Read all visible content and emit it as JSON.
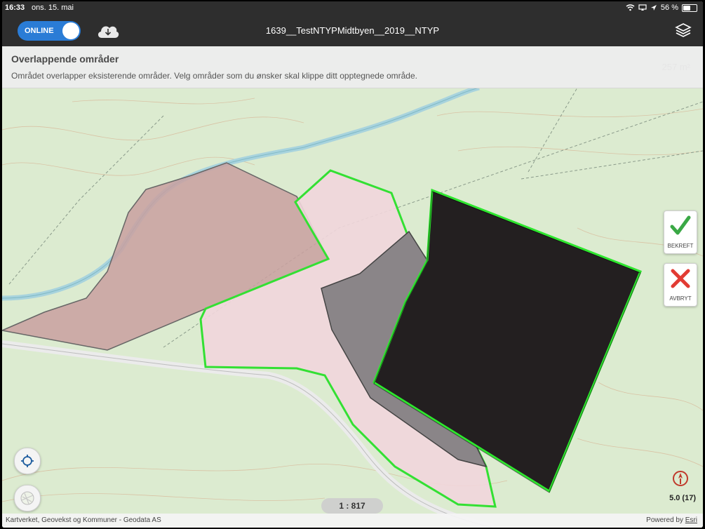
{
  "status_bar": {
    "time": "16:33",
    "date": "ons. 15. mai",
    "battery": "56 %",
    "battery_level": 0.56
  },
  "toolbar": {
    "online_label": "ONLINE",
    "title": "1639__TestNTYPMidtbyen__2019__NTYP"
  },
  "banner": {
    "title": "Overlappende områder",
    "message": "Området overlapper eksisterende områder. Velg områder som du ønsker skal klippe ditt opptegnede område.",
    "area": "257 m²"
  },
  "actions": {
    "confirm_label": "BEKREFT",
    "cancel_label": "AVBRYT"
  },
  "map": {
    "scale": "1 : 817",
    "gps_accuracy": "5.0 (17)",
    "attribution": "Kartverket, Geovekst og Kommuner - Geodata AS",
    "powered_by_prefix": "Powered by",
    "powered_by_brand": "Esri"
  },
  "colors": {
    "online_toggle": "#2a7cd6",
    "outline_green": "#2ee62e",
    "confirm_green": "#3aa845",
    "cancel_red": "#e23b33"
  },
  "icons": [
    "download-cloud-icon",
    "layers-icon",
    "checkmark-icon",
    "cross-icon",
    "location-icon",
    "basemap-icon",
    "compass-icon",
    "wifi-icon",
    "battery-icon"
  ]
}
